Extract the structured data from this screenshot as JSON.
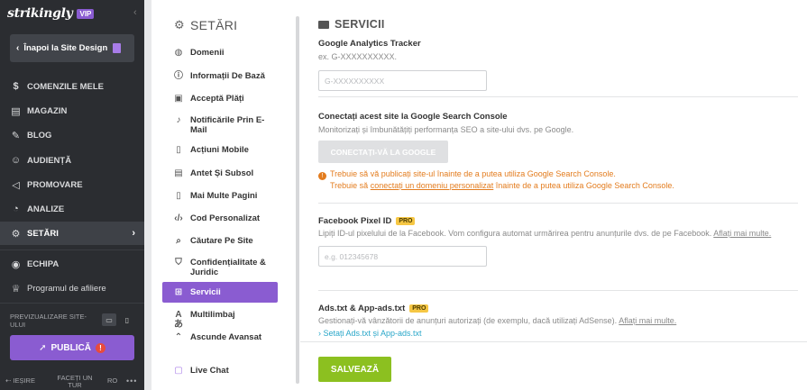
{
  "sidebar": {
    "logo": "strikingly",
    "vip_badge": "VIP",
    "back_label": "Înapoi la Site Design",
    "nav": [
      {
        "label": "COMENZILE MELE",
        "icon": "dollar-icon"
      },
      {
        "label": "MAGAZIN",
        "icon": "store-icon"
      },
      {
        "label": "BLOG",
        "icon": "feather-icon"
      },
      {
        "label": "AUDIENȚĂ",
        "icon": "users-icon"
      },
      {
        "label": "PROMOVARE",
        "icon": "megaphone-icon"
      },
      {
        "label": "ANALIZE",
        "icon": "pie-chart-icon"
      },
      {
        "label": "SETĂRI",
        "icon": "gear-icon"
      }
    ],
    "team_label": "ECHIPA",
    "affiliate_label": "Programul de afiliere",
    "preview_label": "PREVIZUALIZARE SITE-ULUI",
    "publish_label": "PUBLICĂ",
    "publish_warning": "!",
    "footer": {
      "exit": "IEȘIRE",
      "talk": "FACEȚI UN TUR",
      "lang": "RO",
      "more": "•••"
    }
  },
  "settings": {
    "title": "SETĂRI",
    "items": [
      {
        "label": "Domenii",
        "icon": "globe-icon"
      },
      {
        "label": "Informații De Bază",
        "icon": "info-icon"
      },
      {
        "label": "Acceptă Plăți",
        "icon": "payment-icon"
      },
      {
        "label": "Notificările Prin E-Mail",
        "icon": "bell-icon"
      },
      {
        "label": "Acțiuni Mobile",
        "icon": "mobile-icon"
      },
      {
        "label": "Antet Și Subsol",
        "icon": "layout-icon"
      },
      {
        "label": "Mai Multe Pagini",
        "icon": "pages-icon"
      },
      {
        "label": "Cod Personalizat",
        "icon": "code-icon"
      },
      {
        "label": "Căutare Pe Site",
        "icon": "search-icon"
      },
      {
        "label": "Confidențialitate & Juridic",
        "icon": "shield-icon"
      },
      {
        "label": "Servicii",
        "icon": "grid-icon"
      },
      {
        "label": "Multilimbaj",
        "icon": "language-icon"
      },
      {
        "label": "Ascunde Avansat",
        "icon": "chevron-up-icon"
      },
      {
        "label": "Live Chat",
        "icon": "chat-icon"
      }
    ]
  },
  "main": {
    "title": "SERVICII",
    "ga": {
      "heading": "Google Analytics Tracker",
      "hint": "ex. G-XXXXXXXXXX.",
      "placeholder": "G-XXXXXXXXXX"
    },
    "gsc": {
      "heading": "Conectați acest site la Google Search Console",
      "desc": "Monitorizați și îmbunătățiți performanța SEO a site-ului dvs. pe Google.",
      "button": "CONECTAȚI-VĂ LA GOOGLE",
      "warn1": "Trebuie să vă publicați site-ul înainte de a putea utiliza Google Search Console.",
      "warn2_pre": "Trebuie să ",
      "warn2_link": "conectați un domeniu personalizat",
      "warn2_post": " înainte de a putea utiliza Google Search Console."
    },
    "fb": {
      "heading": "Facebook Pixel ID",
      "badge": "PRO",
      "desc": "Lipiți ID-ul pixelului de la Facebook. Vom configura automat urmărirea pentru anunțurile dvs. de pe Facebook.",
      "link": "Aflați mai multe.",
      "placeholder": "e.g. 012345678"
    },
    "ads": {
      "heading": "Ads.txt & App-ads.txt",
      "badge": "PRO",
      "desc": "Gestionați-vă vânzătorii de anunțuri autorizați (de exemplu, dacă utilizați AdSense).",
      "link": "Aflați mai multe.",
      "setup_link": "› Setați Ads.txt și App-ads.txt"
    },
    "save_label": "SALVEAZĂ"
  }
}
